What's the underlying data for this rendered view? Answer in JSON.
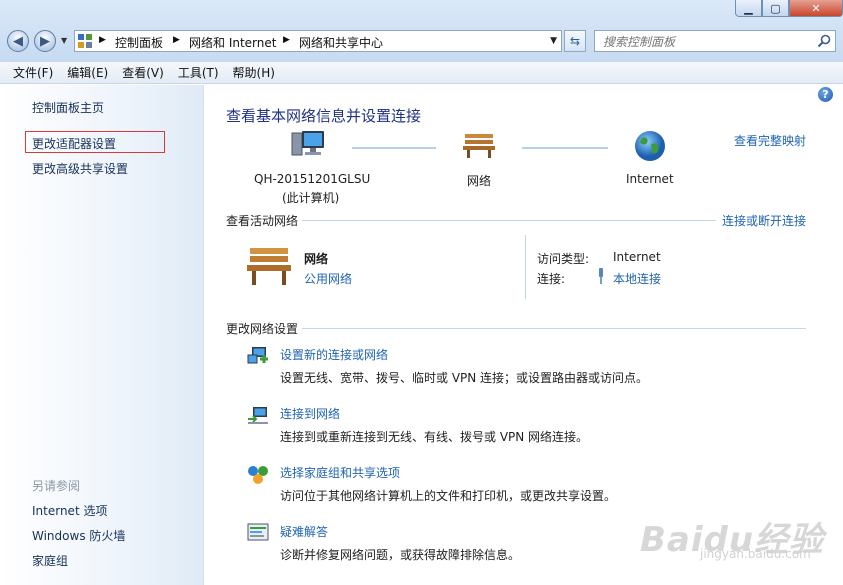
{
  "address": {
    "breadcrumbs": [
      "控制面板",
      "网络和 Internet",
      "网络和共享中心"
    ]
  },
  "search": {
    "placeholder": "搜索控制面板"
  },
  "menu": [
    "文件(F)",
    "编辑(E)",
    "查看(V)",
    "工具(T)",
    "帮助(H)"
  ],
  "sidebar": {
    "home": "控制面板主页",
    "links": [
      "更改适配器设置",
      "更改高级共享设置"
    ],
    "see_also_heading": "另请参阅",
    "see_also": [
      "Internet 选项",
      "Windows 防火墙",
      "家庭组"
    ]
  },
  "main": {
    "title": "查看基本网络信息并设置连接",
    "view_full_map": "查看完整映射",
    "nodes": {
      "computer_name": "QH-20151201GLSU",
      "computer_sub": "(此计算机)",
      "network": "网络",
      "internet": "Internet"
    },
    "active_section": {
      "title": "查看活动网络",
      "link": "连接或断开连接",
      "network_name": "网络",
      "network_type": "公用网络",
      "access_type_label": "访问类型:",
      "access_type_value": "Internet",
      "connection_label": "连接:",
      "connection_value": "本地连接"
    },
    "change_section": {
      "title": "更改网络设置",
      "tasks": [
        {
          "title": "设置新的连接或网络",
          "desc": "设置无线、宽带、拨号、临时或 VPN 连接；或设置路由器或访问点。"
        },
        {
          "title": "连接到网络",
          "desc": "连接到或重新连接到无线、有线、拨号或 VPN 网络连接。"
        },
        {
          "title": "选择家庭组和共享选项",
          "desc": "访问位于其他网络计算机上的文件和打印机，或更改共享设置。"
        },
        {
          "title": "疑难解答",
          "desc": "诊断并修复网络问题，或获得故障排除信息。"
        }
      ]
    }
  },
  "watermark": {
    "brand": "Baidu经验",
    "url": "jingyan.baidu.com"
  },
  "icons": [
    "back-icon",
    "forward-icon",
    "control-panel-icon",
    "refresh-icon",
    "search-icon",
    "help-icon",
    "computer-icon",
    "network-bench-icon",
    "globe-icon",
    "plug-icon",
    "new-connection-icon",
    "connect-network-icon",
    "homegroup-icon",
    "troubleshoot-icon"
  ]
}
